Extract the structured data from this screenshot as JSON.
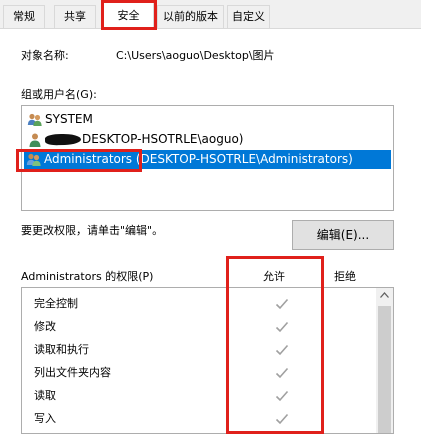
{
  "tabs": [
    {
      "label": "常规",
      "active": false
    },
    {
      "label": "共享",
      "active": false
    },
    {
      "label": "安全",
      "active": true
    },
    {
      "label": "以前的版本",
      "active": false
    },
    {
      "label": "自定义",
      "active": false
    }
  ],
  "object_name": {
    "label": "对象名称:",
    "value": "C:\\Users\\aoguo\\Desktop\\图片"
  },
  "group_users_label": "组或用户名(G):",
  "users": [
    {
      "name": "SYSTEM",
      "icon": "users-group-icon",
      "selected": false
    },
    {
      "name": "DESKTOP-HSOTRLE\\aoguo)",
      "icon": "user-icon",
      "selected": false,
      "redacted_prefix": true
    },
    {
      "name": "Administrators (DESKTOP-HSOTRLE\\Administrators)",
      "icon": "users-group-icon",
      "selected": true
    }
  ],
  "change_perm_hint": "要更改权限，请单击\"编辑\"。",
  "edit_button": "编辑(E)...",
  "perm_header": {
    "title": "Administrators 的权限(P)",
    "allow": "允许",
    "deny": "拒绝"
  },
  "permissions": [
    {
      "name": "完全控制",
      "allow": true,
      "deny": false
    },
    {
      "name": "修改",
      "allow": true,
      "deny": false
    },
    {
      "name": "读取和执行",
      "allow": true,
      "deny": false
    },
    {
      "name": "列出文件夹内容",
      "allow": true,
      "deny": false
    },
    {
      "name": "读取",
      "allow": true,
      "deny": false
    },
    {
      "name": "写入",
      "allow": true,
      "deny": false
    }
  ],
  "colors": {
    "selection": "#0078d7",
    "highlight": "#e0201b",
    "check": "#a0a0a0"
  }
}
